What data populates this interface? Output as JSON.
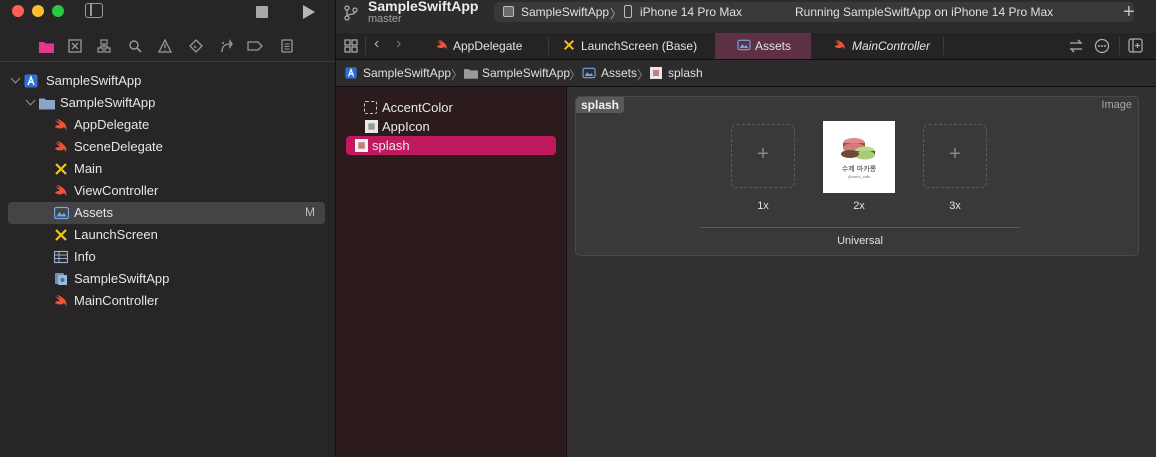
{
  "window": {
    "traffic_lights": {
      "close": "#ff5f57",
      "minimize": "#febc2e",
      "zoom": "#28c840"
    }
  },
  "toolbar": {
    "project_title": "SampleSwiftApp",
    "branch": "master",
    "scheme": "SampleSwiftApp",
    "device": "iPhone 14 Pro Max",
    "status": "Running SampleSwiftApp on iPhone 14 Pro Max"
  },
  "navigator_icons": [
    "folder-icon",
    "source-control-icon",
    "symbol-icon",
    "find-icon",
    "issue-icon",
    "test-icon",
    "debug-icon",
    "breakpoint-icon",
    "report-icon"
  ],
  "tree": {
    "project": "SampleSwiftApp",
    "group": "SampleSwiftApp",
    "items": [
      {
        "label": "AppDelegate",
        "icon": "swift-icon"
      },
      {
        "label": "SceneDelegate",
        "icon": "swift-icon"
      },
      {
        "label": "Main",
        "icon": "storyboard-icon"
      },
      {
        "label": "ViewController",
        "icon": "swift-icon"
      },
      {
        "label": "Assets",
        "icon": "asset-catalog-icon",
        "badge": "M",
        "selected": true
      },
      {
        "label": "LaunchScreen",
        "icon": "storyboard-icon"
      },
      {
        "label": "Info",
        "icon": "plist-icon"
      },
      {
        "label": "SampleSwiftApp",
        "icon": "entitlements-icon"
      },
      {
        "label": "MainController",
        "icon": "swift-icon"
      }
    ]
  },
  "tabs": [
    {
      "label": "AppDelegate",
      "icon": "swift-icon"
    },
    {
      "label": "LaunchScreen (Base)",
      "icon": "storyboard-icon"
    },
    {
      "label": "Assets",
      "icon": "asset-catalog-icon",
      "active": true
    },
    {
      "label": "MainController",
      "icon": "swift-icon",
      "italic": true
    }
  ],
  "jumpbar": {
    "project": "SampleSwiftApp",
    "group": "SampleSwiftApp",
    "catalog": "Assets",
    "asset": "splash"
  },
  "asset_list": [
    {
      "label": "AccentColor",
      "icon": "color-set-icon"
    },
    {
      "label": "AppIcon",
      "icon": "app-icon-set-icon"
    },
    {
      "label": "splash",
      "icon": "image-set-icon",
      "selected": true
    }
  ],
  "detail": {
    "name": "splash",
    "type": "Image",
    "slots": [
      {
        "scale": "1x",
        "filled": false
      },
      {
        "scale": "2x",
        "filled": true,
        "image_text": "수제 마카롱",
        "image_subtext": "@cand_cafe"
      },
      {
        "scale": "3x",
        "filled": false
      }
    ],
    "idiom": "Universal"
  },
  "colors": {
    "accent_selected": "#c0195d",
    "active_tab": "#5d3043",
    "swift": "#f05138",
    "storyboard": "#f5c518",
    "folder": "#8aa5c9"
  }
}
